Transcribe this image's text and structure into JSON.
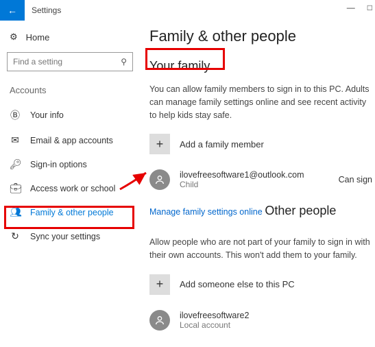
{
  "titlebar": {
    "title": "Settings"
  },
  "sidebar": {
    "home": "Home",
    "search_placeholder": "Find a setting",
    "section": "Accounts",
    "items": [
      {
        "label": "Your info"
      },
      {
        "label": "Email & app accounts"
      },
      {
        "label": "Sign-in options"
      },
      {
        "label": "Access work or school"
      },
      {
        "label": "Family & other people"
      },
      {
        "label": "Sync your settings"
      }
    ]
  },
  "main": {
    "title": "Family & other people",
    "family": {
      "heading": "Your family",
      "desc": "You can allow family members to sign in to this PC. Adults can manage family settings online and see recent activity to help kids stay safe.",
      "add_label": "Add a family member",
      "member": {
        "email": "ilovefreesoftware1@outlook.com",
        "role": "Child",
        "status": "Can sign"
      },
      "manage_link": "Manage family settings online"
    },
    "other": {
      "heading": "Other people",
      "desc": "Allow people who are not part of your family to sign in with their own accounts. This won't add them to your family.",
      "add_label": "Add someone else to this PC",
      "member": {
        "name": "ilovefreesoftware2",
        "role": "Local account"
      }
    }
  }
}
